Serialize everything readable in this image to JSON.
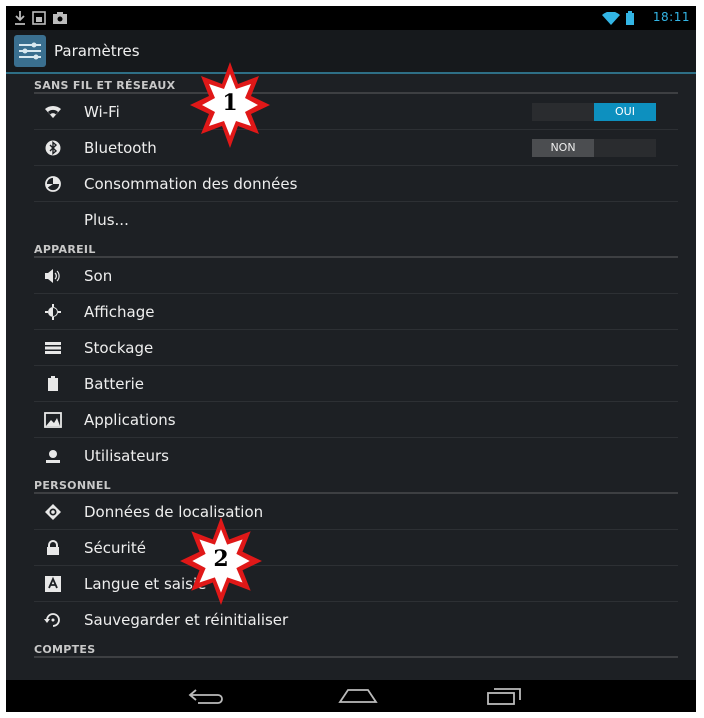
{
  "status_bar": {
    "time": "18:11",
    "accent": "#33b5e5"
  },
  "action_bar": {
    "title": "Paramètres",
    "icon": "settings-icon"
  },
  "sections": [
    {
      "header": "SANS FIL ET RÉSEAUX",
      "items": [
        {
          "label": "Wi-Fi",
          "icon": "wifi-icon",
          "toggle": "OUI"
        },
        {
          "label": "Bluetooth",
          "icon": "bluetooth-icon",
          "toggle": "NON"
        },
        {
          "label": "Consommation des données",
          "icon": "data-usage-icon"
        },
        {
          "label": "Plus...",
          "icon": ""
        }
      ]
    },
    {
      "header": "APPAREIL",
      "items": [
        {
          "label": "Son",
          "icon": "sound-icon"
        },
        {
          "label": "Affichage",
          "icon": "display-icon"
        },
        {
          "label": "Stockage",
          "icon": "storage-icon"
        },
        {
          "label": "Batterie",
          "icon": "battery-icon"
        },
        {
          "label": "Applications",
          "icon": "apps-icon"
        },
        {
          "label": "Utilisateurs",
          "icon": "users-icon"
        }
      ]
    },
    {
      "header": "PERSONNEL",
      "items": [
        {
          "label": "Données de localisation",
          "icon": "location-icon"
        },
        {
          "label": "Sécurité",
          "icon": "lock-icon"
        },
        {
          "label": "Langue et saisie",
          "icon": "language-icon"
        },
        {
          "label": "Sauvegarder et réinitialiser",
          "icon": "backup-icon"
        }
      ]
    },
    {
      "header": "COMPTES",
      "items": []
    }
  ],
  "annotations": [
    {
      "number": "1"
    },
    {
      "number": "2"
    }
  ],
  "nav_bar": {
    "back": "back-icon",
    "home": "home-icon",
    "recents": "recent-apps-icon"
  }
}
